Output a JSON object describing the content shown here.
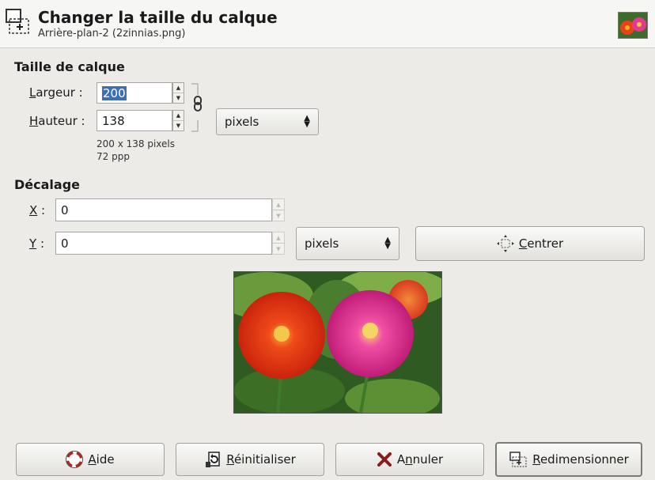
{
  "header": {
    "title": "Changer la taille du calque",
    "subtitle": "Arrière-plan-2 (2zinnias.png)"
  },
  "layer_size": {
    "section_title": "Taille de calque",
    "width_label_key": "L",
    "width_label_rest": "argeur :",
    "width_value": "200",
    "height_label_key": "H",
    "height_label_rest": "auteur :",
    "height_value": "138",
    "unit": "pixels",
    "size_info": "200 x 138 pixels",
    "resolution_info": "72 ppp"
  },
  "offset": {
    "section_title": "Décalage",
    "x_label_key": "X",
    "x_label_rest": " :",
    "x_value": "0",
    "y_label_key": "Y",
    "y_label_rest": " :",
    "y_value": "0",
    "unit": "pixels",
    "center_key": "C",
    "center_rest": "entrer"
  },
  "buttons": {
    "help_key": "A",
    "help_rest": "ide",
    "reset_key": "R",
    "reset_rest": "éinitialiser",
    "cancel_pre": "A",
    "cancel_key": "n",
    "cancel_rest": "nuler",
    "resize_key": "R",
    "resize_rest": "edimensionner"
  },
  "icons": {
    "title": "resize-layer-icon",
    "chain": "chain-link-icon",
    "center": "center-arrows-icon",
    "help": "help-lifebuoy-icon",
    "reset": "reset-icon",
    "cancel": "cancel-x-icon",
    "resize": "resize-layer-icon"
  },
  "colors": {
    "dialog_bg": "#ecebe8",
    "field_bg": "#ffffff",
    "selection": "#3d6fb5",
    "cancel_icon": "#8b1a1a"
  }
}
